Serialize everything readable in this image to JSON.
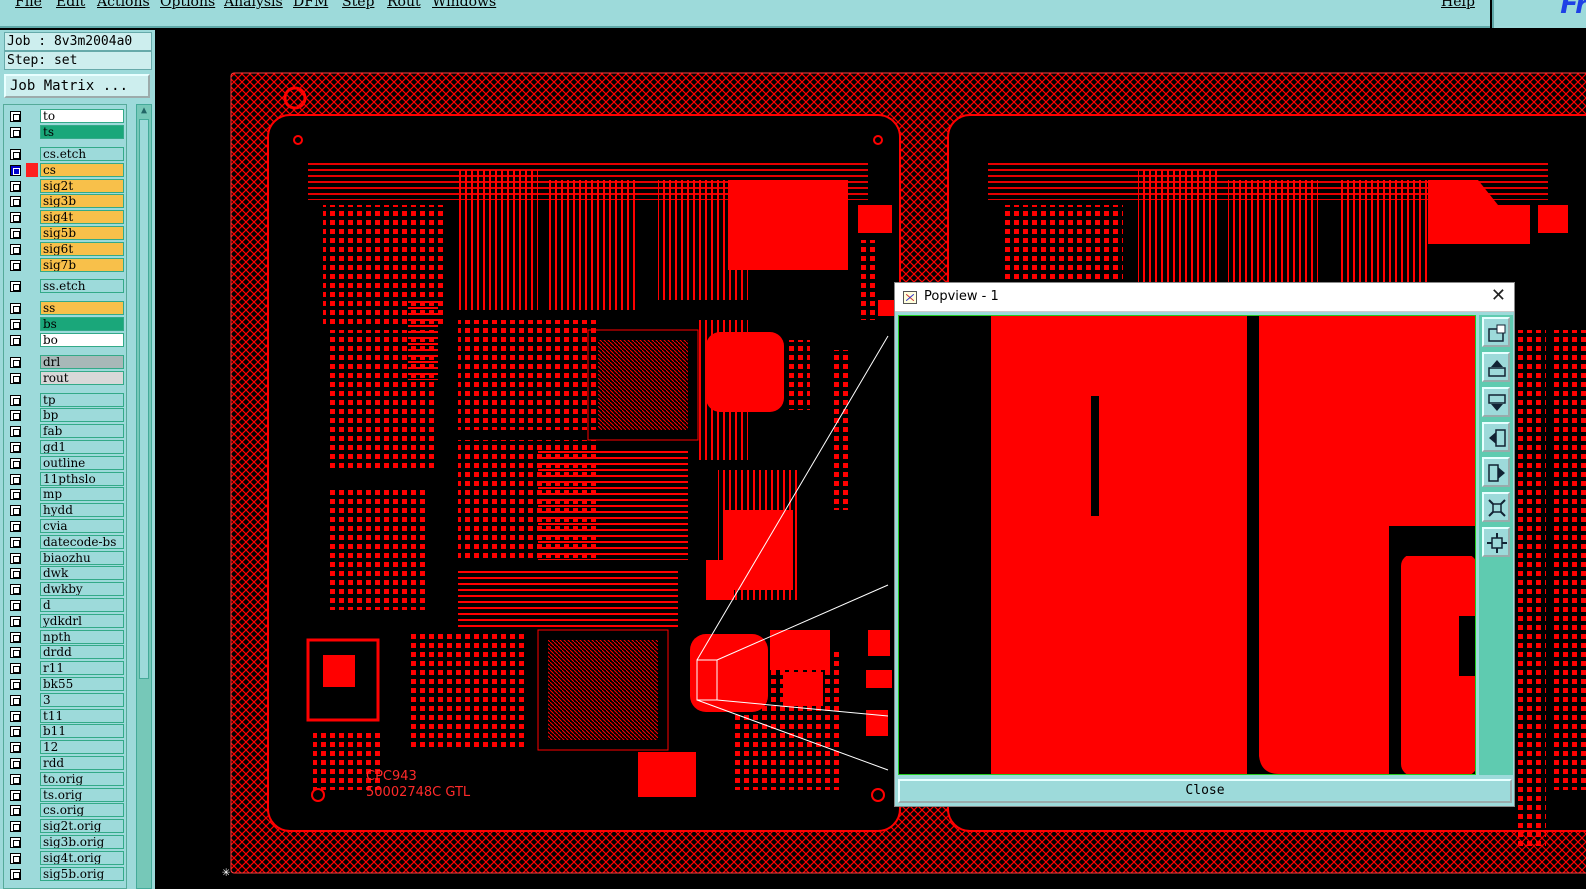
{
  "menu": [
    "File",
    "Edit",
    "Actions",
    "Options",
    "Analysis",
    "DFM",
    "Step",
    "Rout",
    "Windows"
  ],
  "help_label": "Help",
  "logo_text": "Fr",
  "job": {
    "job_line": "Job : 8v3m2004a0",
    "step_line": "Step: set",
    "matrix_button": "Job Matrix ..."
  },
  "layers": [
    {
      "name": "to",
      "color": "white"
    },
    {
      "name": "ts",
      "color": "green"
    },
    {
      "name": "cs.etch",
      "color": "cyan"
    },
    {
      "name": "cs",
      "color": "orange",
      "active": true
    },
    {
      "name": "sig2t",
      "color": "orange"
    },
    {
      "name": "sig3b",
      "color": "orange"
    },
    {
      "name": "sig4t",
      "color": "orange"
    },
    {
      "name": "sig5b",
      "color": "orange"
    },
    {
      "name": "sig6t",
      "color": "orange"
    },
    {
      "name": "sig7b",
      "color": "orange"
    },
    {
      "name": "ss.etch",
      "color": "cyan"
    },
    {
      "name": "ss",
      "color": "orange"
    },
    {
      "name": "bs",
      "color": "green"
    },
    {
      "name": "bo",
      "color": "white"
    },
    {
      "name": "drl",
      "color": "grey"
    },
    {
      "name": "rout",
      "color": "lgrey"
    },
    {
      "name": "tp",
      "color": "cyan"
    },
    {
      "name": "bp",
      "color": "cyan"
    },
    {
      "name": "fab",
      "color": "cyan"
    },
    {
      "name": "gd1",
      "color": "cyan"
    },
    {
      "name": "outline",
      "color": "cyan"
    },
    {
      "name": "11pthslo",
      "color": "cyan"
    },
    {
      "name": "mp",
      "color": "cyan"
    },
    {
      "name": "hydd",
      "color": "cyan"
    },
    {
      "name": "cvia",
      "color": "cyan"
    },
    {
      "name": "datecode-bs",
      "color": "cyan"
    },
    {
      "name": "biaozhu",
      "color": "cyan"
    },
    {
      "name": "dwk",
      "color": "cyan"
    },
    {
      "name": "dwkby",
      "color": "cyan"
    },
    {
      "name": "d",
      "color": "cyan"
    },
    {
      "name": "ydkdrl",
      "color": "cyan"
    },
    {
      "name": "npth",
      "color": "cyan"
    },
    {
      "name": "drdd",
      "color": "cyan"
    },
    {
      "name": "r11",
      "color": "cyan"
    },
    {
      "name": "bk55",
      "color": "cyan"
    },
    {
      "name": "3",
      "color": "cyan"
    },
    {
      "name": "t11",
      "color": "cyan"
    },
    {
      "name": "b11",
      "color": "cyan"
    },
    {
      "name": "12",
      "color": "cyan"
    },
    {
      "name": "rdd",
      "color": "cyan"
    },
    {
      "name": "to.orig",
      "color": "cyan"
    },
    {
      "name": "ts.orig",
      "color": "cyan"
    },
    {
      "name": "cs.orig",
      "color": "cyan"
    },
    {
      "name": "sig2t.orig",
      "color": "cyan"
    },
    {
      "name": "sig3b.orig",
      "color": "cyan"
    },
    {
      "name": "sig4t.orig",
      "color": "cyan"
    },
    {
      "name": "sig5b.orig",
      "color": "cyan"
    }
  ],
  "board_text": {
    "line1": "CPC943",
    "line2": "50002748C GTL"
  },
  "popview": {
    "title": "Popview - 1",
    "close_label": "Close",
    "tools": [
      "zoom-window-icon",
      "pan-up-icon",
      "pan-down-icon",
      "pan-left-icon",
      "pan-right-icon",
      "zoom-out-icon",
      "fit-icon"
    ]
  },
  "colors": {
    "copper": "#ff0000",
    "ui_bg": "#9ddada",
    "active_layer": "#f8c04a"
  }
}
